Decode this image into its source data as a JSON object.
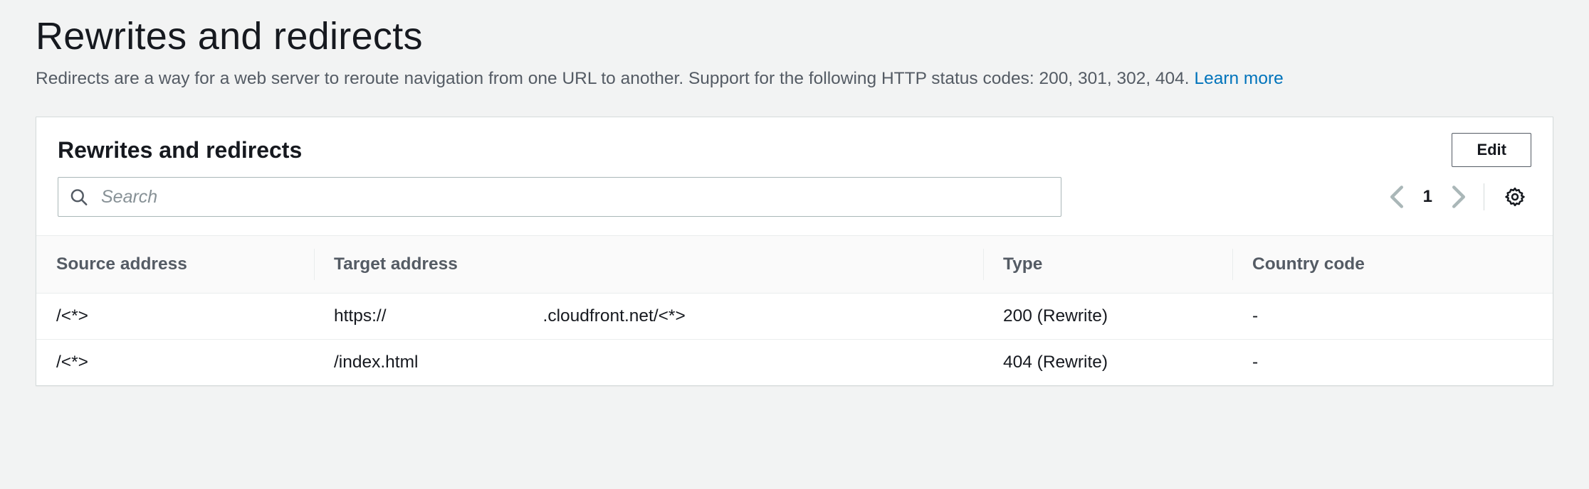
{
  "page": {
    "title": "Rewrites and redirects",
    "description": "Redirects are a way for a web server to reroute navigation from one URL to another. Support for the following HTTP status codes: 200, 301, 302, 404.",
    "learn_more_label": "Learn more"
  },
  "card": {
    "title": "Rewrites and redirects",
    "edit_label": "Edit"
  },
  "search": {
    "placeholder": "Search"
  },
  "pager": {
    "page": "1"
  },
  "columns": {
    "source": "Source address",
    "target": "Target address",
    "type": "Type",
    "country": "Country code"
  },
  "rows": [
    {
      "source": "/<*>",
      "target_prefix": "https://",
      "target_suffix": ".cloudfront.net/<*>",
      "type": "200 (Rewrite)",
      "country": "-"
    },
    {
      "source": "/<*>",
      "target_prefix": "/index.html",
      "target_suffix": "",
      "type": "404 (Rewrite)",
      "country": "-"
    }
  ]
}
